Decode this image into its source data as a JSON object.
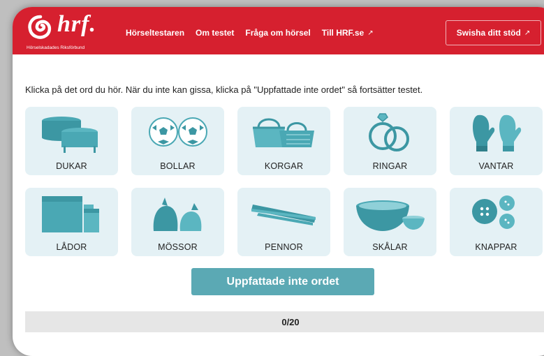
{
  "header": {
    "logo_text": "hrf.",
    "logo_subtitle": "Hörselskadades Riksförbund",
    "nav": [
      {
        "label": "Hörseltestaren"
      },
      {
        "label": "Om testet"
      },
      {
        "label": "Fråga om hörsel"
      },
      {
        "label": "Till HRF.se",
        "external_icon": "↗"
      }
    ],
    "donate_label": "Swisha ditt stöd",
    "donate_icon": "↗"
  },
  "main": {
    "instruction": "Klicka på det ord du hör. När du inte kan gissa, klicka på \"Uppfattade inte ordet\" så fortsätter testet.",
    "words": [
      {
        "label": "DUKAR",
        "icon": "tablecloth-icon"
      },
      {
        "label": "BOLLAR",
        "icon": "balls-icon"
      },
      {
        "label": "KORGAR",
        "icon": "baskets-icon"
      },
      {
        "label": "RINGAR",
        "icon": "rings-icon"
      },
      {
        "label": "VANTAR",
        "icon": "mittens-icon"
      },
      {
        "label": "LÅDOR",
        "icon": "boxes-icon"
      },
      {
        "label": "MÖSSOR",
        "icon": "hats-icon"
      },
      {
        "label": "PENNOR",
        "icon": "pens-icon"
      },
      {
        "label": "SKÅLAR",
        "icon": "bowls-icon"
      },
      {
        "label": "KNAPPAR",
        "icon": "buttons-icon"
      }
    ],
    "skip_label": "Uppfattade inte ordet",
    "progress": "0/20"
  },
  "colors": {
    "brand_red": "#d6202f",
    "teal": "#5ba9b4",
    "card_bg": "#e4f1f5",
    "icon_teal": "#4aa8b4"
  }
}
